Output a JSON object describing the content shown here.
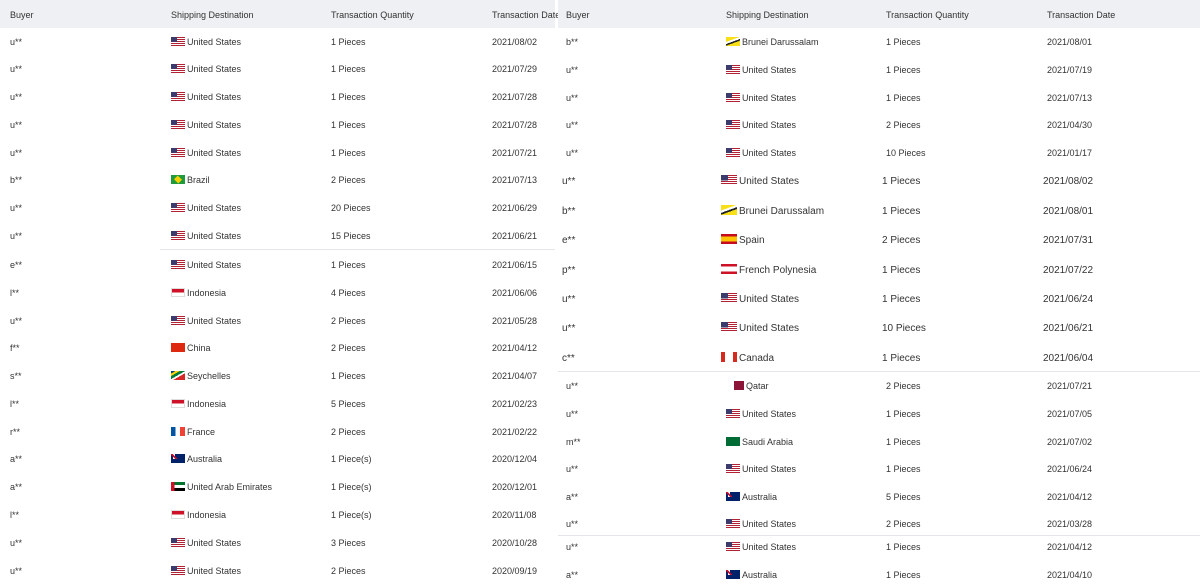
{
  "columns": {
    "buyer": "Buyer",
    "destination": "Shipping Destination",
    "quantity": "Transaction Quantity",
    "date": "Transaction Date"
  },
  "left_rows": [
    {
      "buyer": "u**",
      "flag": "us-flag",
      "destination": "United States",
      "quantity": "1 Pieces",
      "date": "2021/08/02"
    },
    {
      "buyer": "u**",
      "flag": "us-flag",
      "destination": "United States",
      "quantity": "1 Pieces",
      "date": "2021/07/29"
    },
    {
      "buyer": "u**",
      "flag": "us-flag",
      "destination": "United States",
      "quantity": "1 Pieces",
      "date": "2021/07/28"
    },
    {
      "buyer": "u**",
      "flag": "us-flag",
      "destination": "United States",
      "quantity": "1 Pieces",
      "date": "2021/07/28"
    },
    {
      "buyer": "u**",
      "flag": "us-flag",
      "destination": "United States",
      "quantity": "1 Pieces",
      "date": "2021/07/21"
    },
    {
      "buyer": "b**",
      "flag": "br-flag",
      "destination": "Brazil",
      "quantity": "2 Pieces",
      "date": "2021/07/13"
    },
    {
      "buyer": "u**",
      "flag": "us-flag",
      "destination": "United States",
      "quantity": "20 Pieces",
      "date": "2021/06/29"
    },
    {
      "buyer": "u**",
      "flag": "us-flag",
      "destination": "United States",
      "quantity": "15 Pieces",
      "date": "2021/06/21"
    },
    {
      "buyer": "e**",
      "flag": "us-flag",
      "destination": "United States",
      "quantity": "1 Pieces",
      "date": "2021/06/15"
    },
    {
      "buyer": "l**",
      "flag": "id-flag",
      "destination": "Indonesia",
      "quantity": "4 Pieces",
      "date": "2021/06/06"
    },
    {
      "buyer": "u**",
      "flag": "us-flag",
      "destination": "United States",
      "quantity": "2 Pieces",
      "date": "2021/05/28"
    },
    {
      "buyer": "f**",
      "flag": "cn-flag",
      "destination": "China",
      "quantity": "2 Pieces",
      "date": "2021/04/12"
    },
    {
      "buyer": "s**",
      "flag": "sc-flag",
      "destination": "Seychelles",
      "quantity": "1 Pieces",
      "date": "2021/04/07"
    },
    {
      "buyer": "l**",
      "flag": "id-flag",
      "destination": "Indonesia",
      "quantity": "5 Pieces",
      "date": "2021/02/23"
    },
    {
      "buyer": "r**",
      "flag": "fr-flag",
      "destination": "France",
      "quantity": "2 Pieces",
      "date": "2021/02/22"
    },
    {
      "buyer": "a**",
      "flag": "au-flag",
      "destination": "Australia",
      "quantity": "1 Piece(s)",
      "date": "2020/12/04"
    },
    {
      "buyer": "a**",
      "flag": "ae-flag",
      "destination": "United Arab Emirates",
      "quantity": "1 Piece(s)",
      "date": "2020/12/01"
    },
    {
      "buyer": "l**",
      "flag": "id-flag",
      "destination": "Indonesia",
      "quantity": "1 Piece(s)",
      "date": "2020/11/08"
    },
    {
      "buyer": "u**",
      "flag": "us-flag",
      "destination": "United States",
      "quantity": "3 Pieces",
      "date": "2020/10/28"
    },
    {
      "buyer": "u**",
      "flag": "us-flag",
      "destination": "United States",
      "quantity": "2 Pieces",
      "date": "2020/09/19"
    }
  ],
  "right_rows": [
    {
      "buyer": "b**",
      "flag": "bn-flag",
      "destination": "Brunei Darussalam",
      "quantity": "1 Pieces",
      "date": "2021/08/01"
    },
    {
      "buyer": "u**",
      "flag": "us-flag",
      "destination": "United States",
      "quantity": "1 Pieces",
      "date": "2021/07/19"
    },
    {
      "buyer": "u**",
      "flag": "us-flag",
      "destination": "United States",
      "quantity": "1 Pieces",
      "date": "2021/07/13"
    },
    {
      "buyer": "u**",
      "flag": "us-flag",
      "destination": "United States",
      "quantity": "2 Pieces",
      "date": "2021/04/30"
    },
    {
      "buyer": "u**",
      "flag": "us-flag",
      "destination": "United States",
      "quantity": "10 Pieces",
      "date": "2021/01/17"
    },
    {
      "buyer": "u**",
      "flag": "us-flag",
      "destination": "United States",
      "quantity": "1 Pieces",
      "date": "2021/08/02"
    },
    {
      "buyer": "b**",
      "flag": "bn-flag",
      "destination": "Brunei Darussalam",
      "quantity": "1 Pieces",
      "date": "2021/08/01"
    },
    {
      "buyer": "e**",
      "flag": "es-flag",
      "destination": "Spain",
      "quantity": "2 Pieces",
      "date": "2021/07/31"
    },
    {
      "buyer": "p**",
      "flag": "pf-flag",
      "destination": "French Polynesia",
      "quantity": "1 Pieces",
      "date": "2021/07/22"
    },
    {
      "buyer": "u**",
      "flag": "us-flag",
      "destination": "United States",
      "quantity": "1 Pieces",
      "date": "2021/06/24"
    },
    {
      "buyer": "u**",
      "flag": "us-flag",
      "destination": "United States",
      "quantity": "10 Pieces",
      "date": "2021/06/21"
    },
    {
      "buyer": "c**",
      "flag": "ca-flag",
      "destination": "Canada",
      "quantity": "1 Pieces",
      "date": "2021/06/04"
    },
    {
      "buyer": "u**",
      "flag": "qa-flag",
      "destination": "Qatar",
      "quantity": "2 Pieces",
      "date": "2021/07/21"
    },
    {
      "buyer": "u**",
      "flag": "us-flag",
      "destination": "United States",
      "quantity": "1 Pieces",
      "date": "2021/07/05"
    },
    {
      "buyer": "m**",
      "flag": "sa-flag",
      "destination": "Saudi Arabia",
      "quantity": "1 Pieces",
      "date": "2021/07/02"
    },
    {
      "buyer": "u**",
      "flag": "us-flag",
      "destination": "United States",
      "quantity": "1 Pieces",
      "date": "2021/06/24"
    },
    {
      "buyer": "a**",
      "flag": "au-flag",
      "destination": "Australia",
      "quantity": "5 Pieces",
      "date": "2021/04/12"
    },
    {
      "buyer": "u**",
      "flag": "us-flag",
      "destination": "United States",
      "quantity": "2 Pieces",
      "date": "2021/03/28"
    },
    {
      "buyer": "u**",
      "flag": "us-flag",
      "destination": "United States",
      "quantity": "1 Pieces",
      "date": "2021/04/12"
    },
    {
      "buyer": "a**",
      "flag": "au-flag",
      "destination": "Australia",
      "quantity": "1 Pieces",
      "date": "2021/04/10"
    }
  ]
}
